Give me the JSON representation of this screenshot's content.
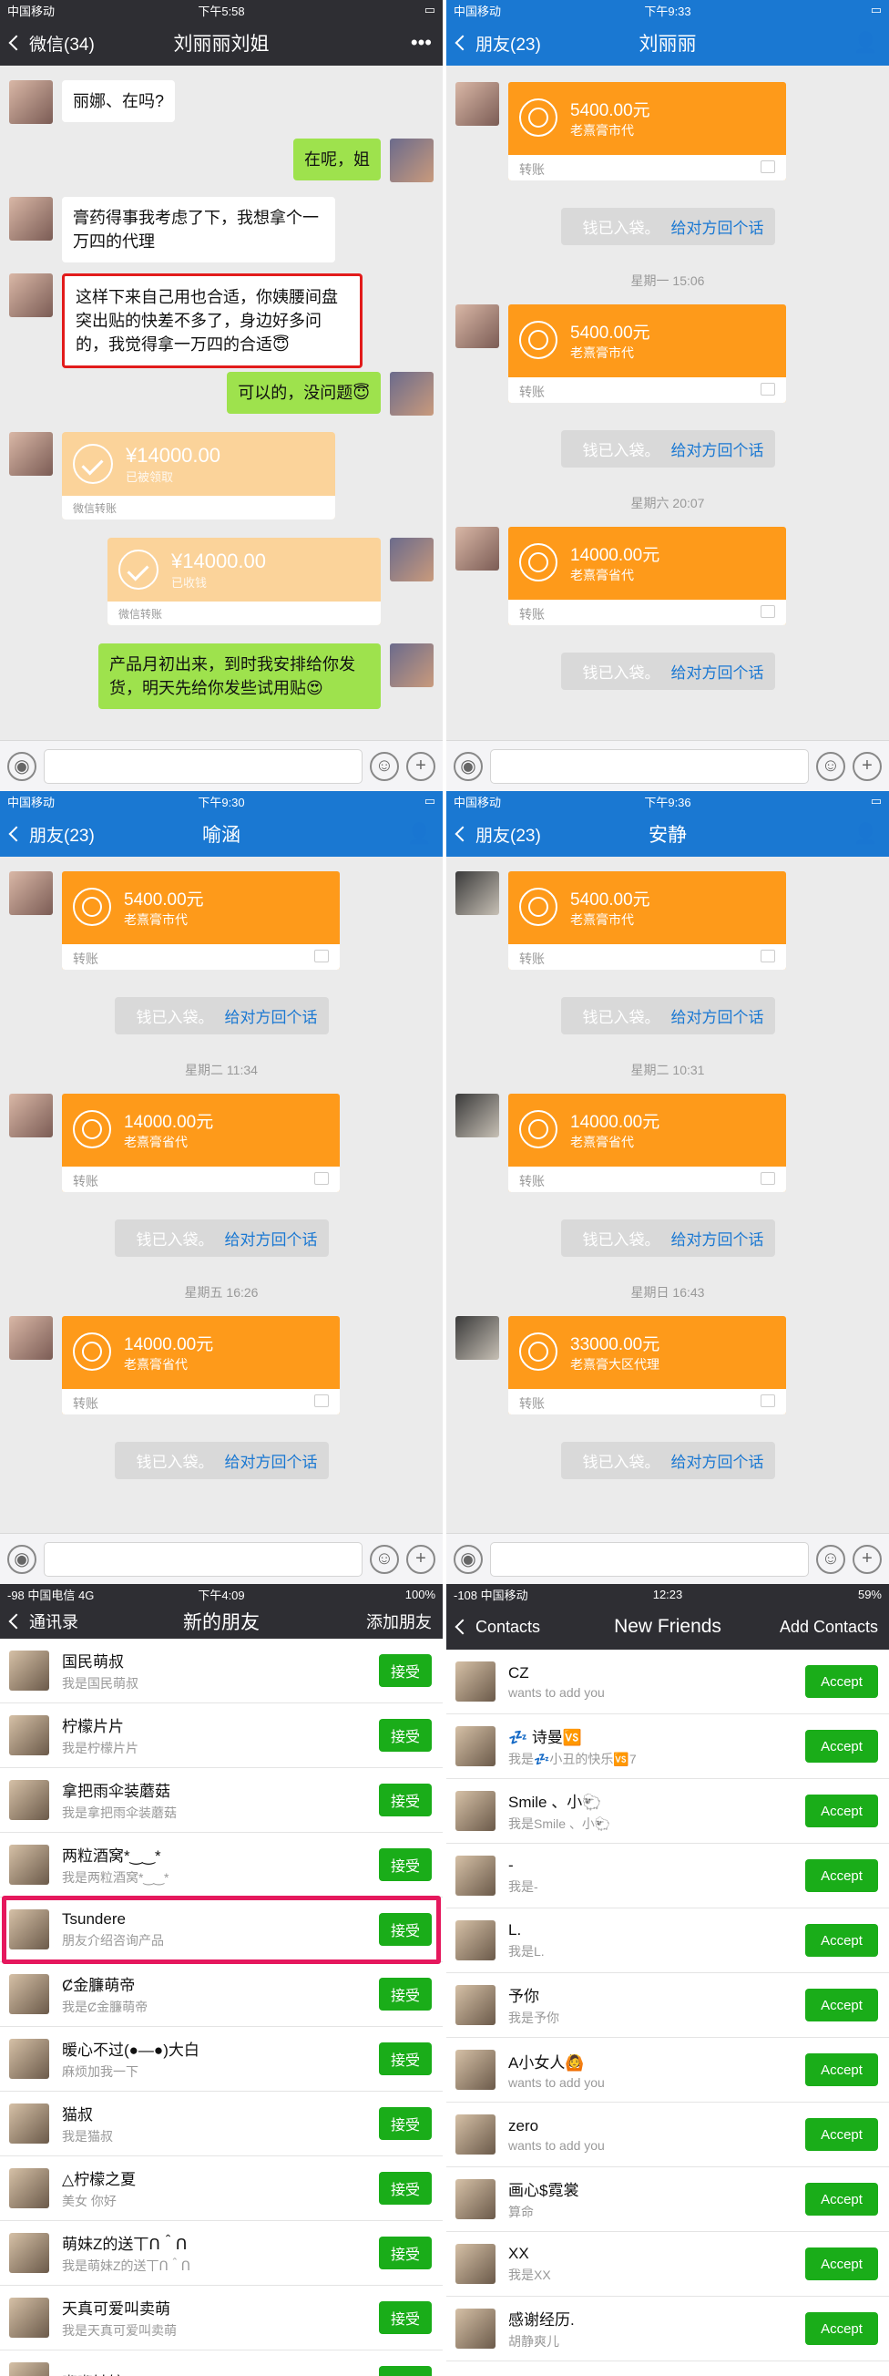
{
  "p1": {
    "carrier": "中国移动",
    "time": "下午5:58",
    "back": "微信(34)",
    "title": "刘丽丽刘姐",
    "more": "•••",
    "m1": "丽娜、在吗?",
    "m2": "在呢，姐",
    "m3": "膏药得事我考虑了下，我想拿个一万四的代理",
    "m4": "这样下来自己用也合适，你姨腰间盘突出贴的快差不多了，身边好多问的，我觉得拿一万四的合适😇",
    "m5": "可以的，没问题😇",
    "x1": {
      "amount": "¥14000.00",
      "status": "已被领取",
      "foot": "微信转账"
    },
    "x2": {
      "amount": "¥14000.00",
      "status": "已收钱",
      "foot": "微信转账"
    },
    "m6": "产品月初出来，到时我安排给你发货，明天先给你发些试用贴😍"
  },
  "p2": {
    "carrier": "中国移动",
    "time": "下午9:33",
    "back": "朋友(23)",
    "title": "刘丽丽",
    "t1": {
      "amount": "5400.00元",
      "sub": "老熹膏市代",
      "foot": "转账"
    },
    "n1": "钱已入袋。",
    "n1l": "给对方回个话",
    "d1": "星期一 15:06",
    "t2": {
      "amount": "5400.00元",
      "sub": "老熹膏市代",
      "foot": "转账"
    },
    "n2": "钱已入袋。",
    "n2l": "给对方回个话",
    "d2": "星期六 20:07",
    "t3": {
      "amount": "14000.00元",
      "sub": "老熹膏省代",
      "foot": "转账"
    },
    "n3": "钱已入袋。",
    "n3l": "给对方回个话"
  },
  "p3": {
    "carrier": "中国移动",
    "time": "下午9:30",
    "back": "朋友(23)",
    "title": "喻涵",
    "t1": {
      "amount": "5400.00元",
      "sub": "老熹膏市代",
      "foot": "转账"
    },
    "n1": "钱已入袋。",
    "n1l": "给对方回个话",
    "d1": "星期二 11:34",
    "t2": {
      "amount": "14000.00元",
      "sub": "老熹膏省代",
      "foot": "转账"
    },
    "n2": "钱已入袋。",
    "n2l": "给对方回个话",
    "d2": "星期五 16:26",
    "t3": {
      "amount": "14000.00元",
      "sub": "老熹膏省代",
      "foot": "转账"
    },
    "n3": "钱已入袋。",
    "n3l": "给对方回个话"
  },
  "p4": {
    "carrier": "中国移动",
    "time": "下午9:36",
    "back": "朋友(23)",
    "title": "安静",
    "t1": {
      "amount": "5400.00元",
      "sub": "老熹膏市代",
      "foot": "转账"
    },
    "n1": "钱已入袋。",
    "n1l": "给对方回个话",
    "d1": "星期二 10:31",
    "t2": {
      "amount": "14000.00元",
      "sub": "老熹膏省代",
      "foot": "转账"
    },
    "n2": "钱已入袋。",
    "n2l": "给对方回个话",
    "d2": "星期日 16:43",
    "t3": {
      "amount": "33000.00元",
      "sub": "老熹膏大区代理",
      "foot": "转账"
    },
    "n3": "钱已入袋。",
    "n3l": "给对方回个话"
  },
  "p5": {
    "carrier": "-98 中国电信 4G",
    "time": "下午4:09",
    "battery": "100%",
    "back": "通讯录",
    "title": "新的朋友",
    "action": "添加朋友",
    "btn": "接受",
    "items": [
      {
        "name": "国民萌叔",
        "desc": "我是国民萌叔"
      },
      {
        "name": "柠檬片片",
        "desc": "我是柠檬片片"
      },
      {
        "name": "拿把雨伞装蘑菇",
        "desc": "我是拿把雨伞装蘑菇"
      },
      {
        "name": "两粒酒窝*‿‿*",
        "desc": "我是两粒酒窝*‿‿*"
      },
      {
        "name": "Tsundere",
        "desc": "朋友介绍咨询产品"
      },
      {
        "name": "Ȼ金臁萌帝",
        "desc": "我是Ȼ金臁萌帝"
      },
      {
        "name": "暖心不过(●—●)大白",
        "desc": "麻烦加我一下"
      },
      {
        "name": "猫叔",
        "desc": "我是猫叔"
      },
      {
        "name": "△柠檬之夏",
        "desc": "美女 你好"
      },
      {
        "name": "萌妹Z的送丅ᑎ＾ᑎ",
        "desc": "我是萌妹Z的送丅ᑎ＾ᑎ"
      },
      {
        "name": "天真可爱叫卖萌",
        "desc": "我是天真可爱叫卖萌"
      },
      {
        "name": "嘟嘟姑娘♪",
        "desc": ""
      }
    ]
  },
  "p6": {
    "carrier": "-108 中国移动",
    "time": "12:23",
    "battery": "59%",
    "back": "Contacts",
    "title": "New Friends",
    "action": "Add Contacts",
    "btn": "Accept",
    "items": [
      {
        "name": "CZ",
        "desc": "wants to add you"
      },
      {
        "name": "💤 诗曼🆚",
        "desc": "我是💤小丑的快乐🆚7"
      },
      {
        "name": "Smile 、小🐑",
        "desc": "我是Smile 、小🐑"
      },
      {
        "name": "-",
        "desc": "我是-"
      },
      {
        "name": "L.",
        "desc": "我是L."
      },
      {
        "name": "予你",
        "desc": "我是予你"
      },
      {
        "name": "A小女人🙆",
        "desc": "wants to add you"
      },
      {
        "name": "zero",
        "desc": "wants to add you"
      },
      {
        "name": "画心$霓裳",
        "desc": "算命"
      },
      {
        "name": "XX",
        "desc": "我是XX"
      },
      {
        "name": "感谢经历.",
        "desc": "胡静爽儿"
      }
    ]
  }
}
